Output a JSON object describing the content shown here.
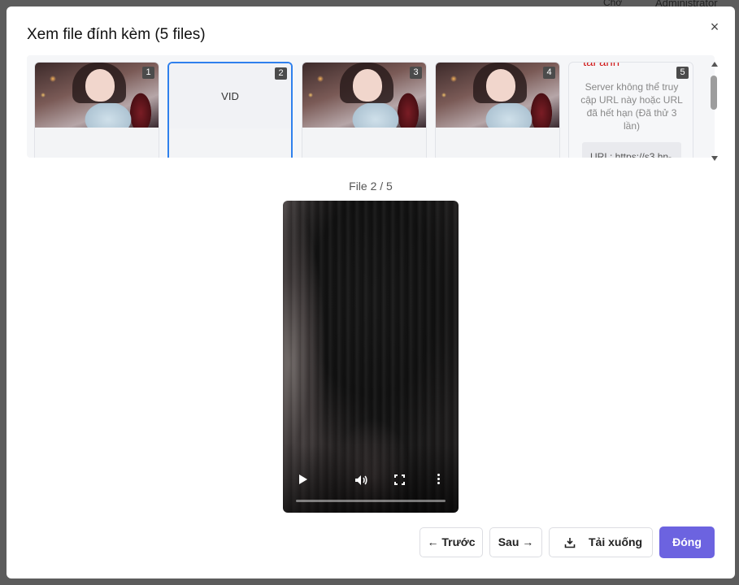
{
  "background": {
    "text1": "Chờ",
    "text2": "Administrator"
  },
  "modal": {
    "title": "Xem file đính kèm (5 files)",
    "close_icon": "×"
  },
  "thumbnails": [
    {
      "index": "1",
      "type": "image"
    },
    {
      "index": "2",
      "type": "video",
      "label": "VID",
      "active": true
    },
    {
      "index": "3",
      "type": "image"
    },
    {
      "index": "4",
      "type": "image"
    },
    {
      "index": "5",
      "type": "error",
      "error_title": "tải ảnh",
      "error_message": "Server không thể truy cập URL này hoặc URL đã hết hạn (Đã thử 3 lần)",
      "url_text": "URL: https://s3.hn-"
    }
  ],
  "counter": "File 2 / 5",
  "player": {
    "progress": 0
  },
  "buttons": {
    "prev": "← Trước",
    "next": "Sau →",
    "download": "Tải xuống",
    "close": "Đóng"
  },
  "colors": {
    "accent": "#6c63e0",
    "active_border": "#2f80ed",
    "error": "#d11a1a"
  }
}
